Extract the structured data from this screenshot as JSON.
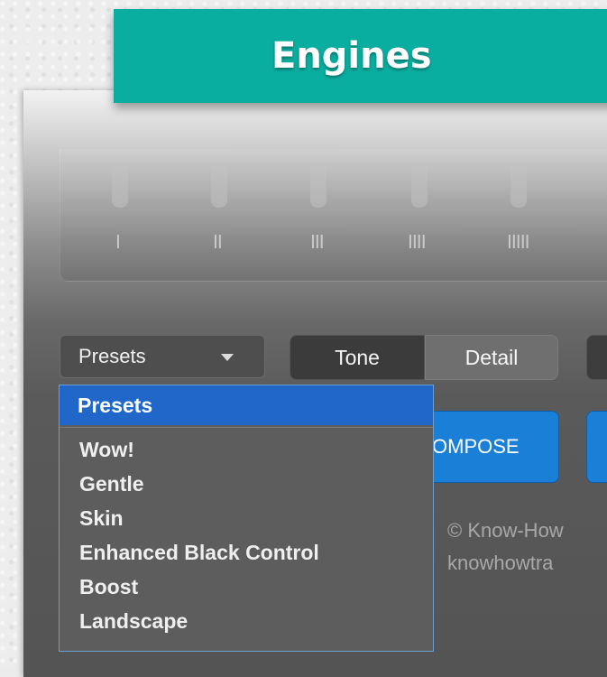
{
  "banner": {
    "title": "Engines"
  },
  "slider_ticks": [
    "I",
    "II",
    "III",
    "IIII",
    "IIIII"
  ],
  "presets_select": {
    "value": "Presets",
    "icon": "chevron-down-icon"
  },
  "segments": [
    {
      "label": "Tone",
      "active": true
    },
    {
      "label": "Detail",
      "active": false
    }
  ],
  "compose_button": {
    "label": "OMPOSE"
  },
  "copyright": {
    "line1": "© Know-How",
    "line2": "knowhowtra"
  },
  "dropdown": {
    "selected": "Presets",
    "options": [
      "Wow!",
      "Gentle",
      "Skin",
      "Enhanced Black Control",
      "Boost",
      "Landscape"
    ]
  },
  "colors": {
    "banner": "#0aaea0",
    "accent_blue": "#1a7fd7",
    "dropdown_selected": "#2166c9"
  }
}
